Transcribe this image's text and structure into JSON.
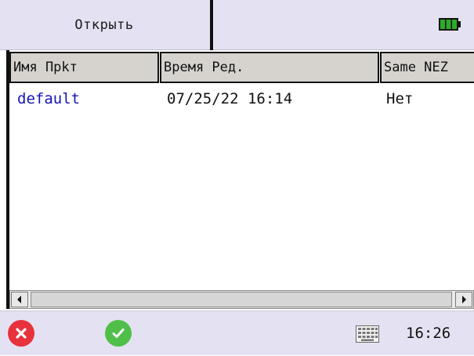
{
  "titlebar": {
    "title": "Открыть",
    "battery_icon": "battery-full-icon"
  },
  "table": {
    "columns": [
      "Имя Прkт",
      "Время Ред.",
      "Same NEZ"
    ],
    "rows": [
      {
        "name": "default",
        "time": "07/25/22 16:14",
        "same_nez": "Нет"
      }
    ]
  },
  "taskbar": {
    "cancel_icon": "close-icon",
    "ok_icon": "checkmark-icon",
    "keyboard_icon": "keyboard-icon",
    "clock": "16:26"
  },
  "colors": {
    "bar_background": "#e4e2f2",
    "header_cell": "#d6d3cf",
    "link_text": "#1414b8",
    "cancel_red": "#e8323c",
    "ok_green": "#4fbf4a",
    "battery_green": "#2faa2a"
  }
}
